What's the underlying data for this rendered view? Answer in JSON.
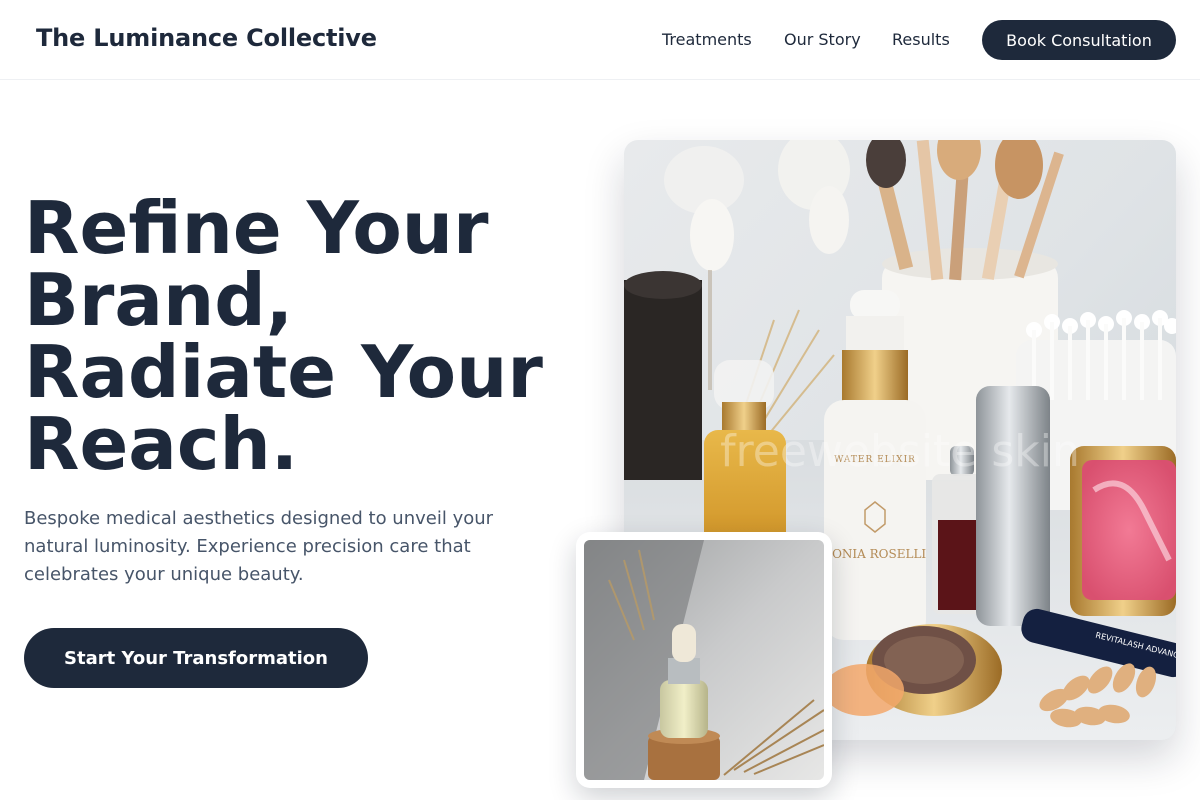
{
  "header": {
    "brand": "The Luminance Collective",
    "nav": [
      {
        "label": "Treatments"
      },
      {
        "label": "Our Story"
      },
      {
        "label": "Results"
      }
    ],
    "cta_label": "Book Consultation"
  },
  "hero": {
    "title_lines": [
      "Refine Your",
      "Brand,",
      "Radiate Your",
      "Reach."
    ],
    "description": "Bespoke medical aesthetics designed to unveil your natural luminosity. Experience precision care that celebrates your unique beauty.",
    "cta_label": "Start Your Transformation"
  },
  "images": {
    "main_alt": "cosmetics-products-photo",
    "inset_alt": "serum-dropper-bottle-photo",
    "product_labels": {
      "serum_brand": "SONIA ROSELLI",
      "serum_name": "WATER ELIXIR",
      "mascara_label": "REVITALASH ADVANCED",
      "watermark": "freewebsite skin"
    }
  },
  "colors": {
    "primary": "#1e293b",
    "text_muted": "#475569",
    "background": "#ffffff"
  }
}
